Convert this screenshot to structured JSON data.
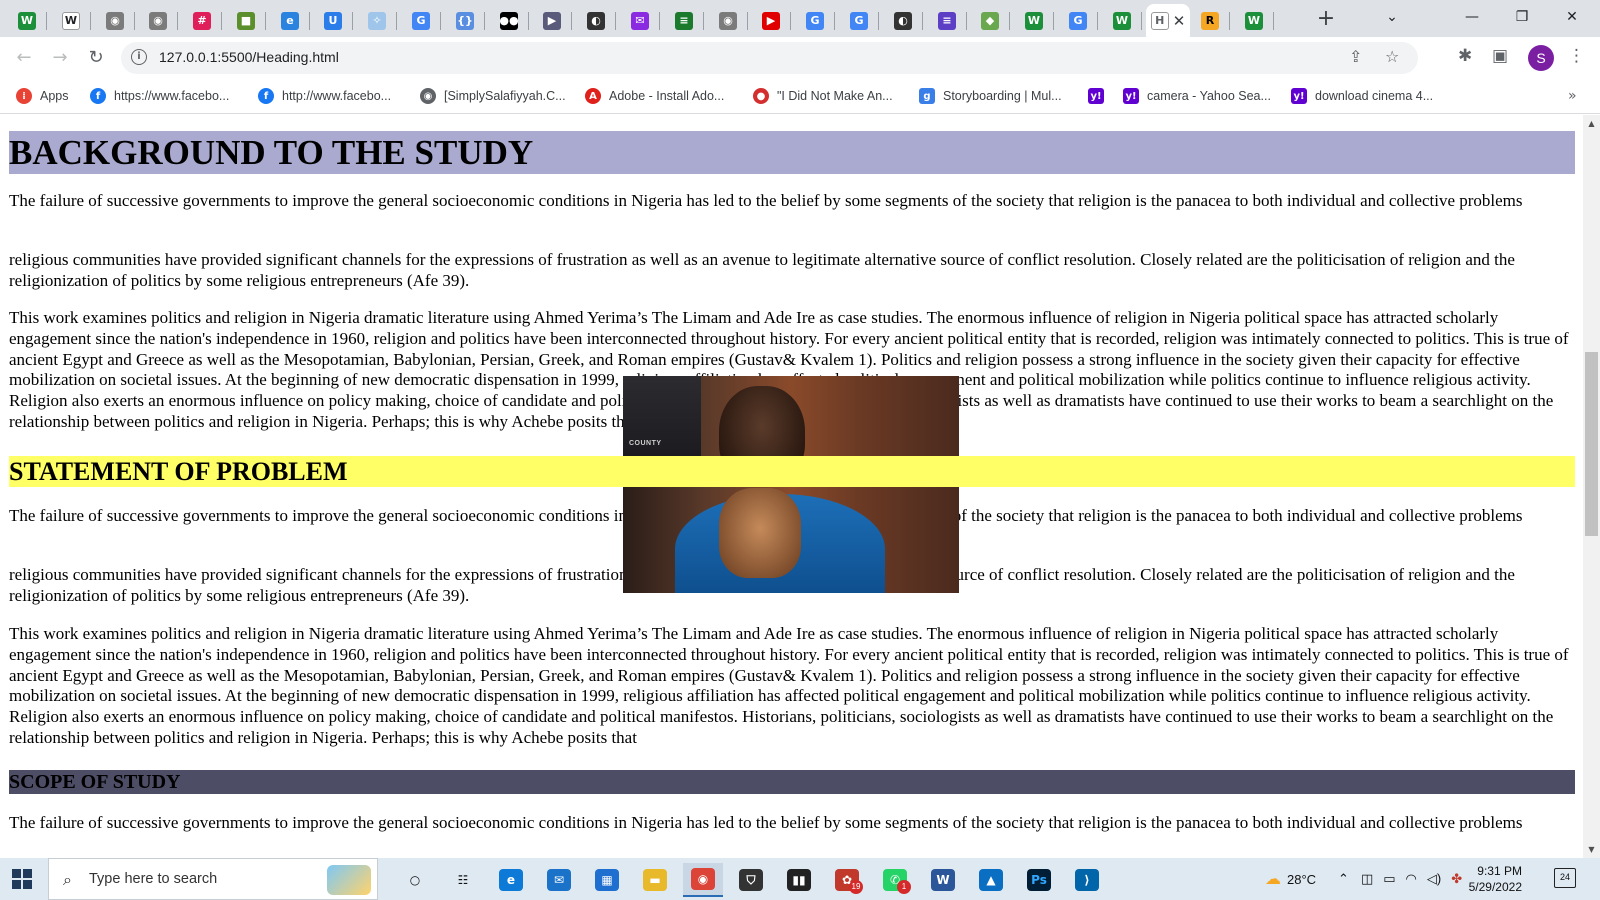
{
  "browser": {
    "tabs": [
      {
        "name": "wikipedia",
        "glyph": "W",
        "color": "#1b8f3a",
        "fg": "#fff"
      },
      {
        "name": "wikipedia-book",
        "glyph": "W",
        "color": "#ffffff",
        "fg": "#202124"
      },
      {
        "name": "globe",
        "glyph": "◉",
        "color": "#7b7b7b",
        "fg": "#fff"
      },
      {
        "name": "globe",
        "glyph": "◉",
        "color": "#7b7b7b",
        "fg": "#fff"
      },
      {
        "name": "slack",
        "glyph": "#",
        "color": "#e01e5a",
        "fg": "#fff"
      },
      {
        "name": "canva",
        "glyph": "■",
        "color": "#5b8f2c",
        "fg": "#fff"
      },
      {
        "name": "edge",
        "glyph": "e",
        "color": "#2b83e0",
        "fg": "#fff"
      },
      {
        "name": "word-u",
        "glyph": "U",
        "color": "#2b7de9",
        "fg": "#fff"
      },
      {
        "name": "spark",
        "glyph": "✧",
        "color": "#9fc6ea",
        "fg": "#fff"
      },
      {
        "name": "google",
        "glyph": "G",
        "color": "#4285f4",
        "fg": "#fff"
      },
      {
        "name": "braces",
        "glyph": "{}",
        "color": "#5a8ee0",
        "fg": "#fff"
      },
      {
        "name": "medium",
        "glyph": "●●",
        "color": "#000000",
        "fg": "#fff"
      },
      {
        "name": "play",
        "glyph": "▶",
        "color": "#5a5a7a",
        "fg": "#fff"
      },
      {
        "name": "github",
        "glyph": "◐",
        "color": "#333333",
        "fg": "#fff"
      },
      {
        "name": "mail",
        "glyph": "✉",
        "color": "#8a2be2",
        "fg": "#fff"
      },
      {
        "name": "foodhub",
        "glyph": "≡",
        "color": "#1b7a2c",
        "fg": "#fff"
      },
      {
        "name": "globe",
        "glyph": "◉",
        "color": "#7b7b7b",
        "fg": "#fff"
      },
      {
        "name": "youtube",
        "glyph": "▶",
        "color": "#e00000",
        "fg": "#fff"
      },
      {
        "name": "google",
        "glyph": "G",
        "color": "#4285f4",
        "fg": "#fff"
      },
      {
        "name": "google",
        "glyph": "G",
        "color": "#4285f4",
        "fg": "#fff"
      },
      {
        "name": "github",
        "glyph": "◐",
        "color": "#333333",
        "fg": "#fff"
      },
      {
        "name": "notes",
        "glyph": "≡",
        "color": "#5c3fc4",
        "fg": "#fff"
      },
      {
        "name": "maps",
        "glyph": "◆",
        "color": "#6aa84f",
        "fg": "#fff"
      },
      {
        "name": "wikipedia",
        "glyph": "W",
        "color": "#1b8f3a",
        "fg": "#fff"
      },
      {
        "name": "google",
        "glyph": "G",
        "color": "#4285f4",
        "fg": "#fff"
      },
      {
        "name": "wikipedia",
        "glyph": "W",
        "color": "#1b8f3a",
        "fg": "#fff"
      },
      {
        "name": "heading-page",
        "glyph": "H",
        "color": "#ffffff",
        "fg": "#5f6368",
        "active": true
      },
      {
        "name": "r-app",
        "glyph": "R",
        "color": "#f5a623",
        "fg": "#000"
      },
      {
        "name": "wikipedia",
        "glyph": "W",
        "color": "#1b8f3a",
        "fg": "#fff"
      }
    ],
    "new_tab_label": "+",
    "window_controls": {
      "tab_search": "⌄",
      "minimize": "—",
      "restore": "❐",
      "close": "✕"
    },
    "url": "127.0.0.1:5500/Heading.html",
    "profile_initial": "S",
    "bookmarks": [
      {
        "label": "Apps",
        "icon": "apps-grid",
        "color": "#e94335"
      },
      {
        "label": "https://www.facebo...",
        "icon": "facebook",
        "color": "#1877f2"
      },
      {
        "label": "http://www.facebo...",
        "icon": "facebook",
        "color": "#1877f2"
      },
      {
        "label": "[SimplySalafiyyah.C...",
        "icon": "globe",
        "color": "#5f6368"
      },
      {
        "label": "Adobe - Install Ado...",
        "icon": "adobe",
        "color": "#e0201a"
      },
      {
        "label": "\"I Did Not Make An...",
        "icon": "pin",
        "color": "#d32f2f"
      },
      {
        "label": "Storyboarding | Mul...",
        "icon": "storyboard",
        "color": "#3a7ee8"
      },
      {
        "label": "",
        "icon": "yahoo",
        "color": "#6001d2"
      },
      {
        "label": "camera - Yahoo Sea...",
        "icon": "yahoo",
        "color": "#6001d2"
      },
      {
        "label": "download cinema 4...",
        "icon": "yahoo",
        "color": "#6001d2"
      }
    ],
    "bookmarks_more": "»"
  },
  "page": {
    "heading1": "BACKGROUND TO THE STUDY",
    "heading2": "STATEMENT OF PROBLEM",
    "heading3": "SCOPE OF STUDY",
    "para1": "The failure of successive governments to improve the general socioeconomic conditions in Nigeria has led to the belief by some segments of the society that religion is the panacea to both individual and collective problems",
    "para2": "religious communities have provided significant channels for the expressions of frustration as well as an avenue to legitimate alternative source of conflict resolution. Closely related are the politicisation of religion and the religionization of politics by some religious entrepreneurs (Afe 39).",
    "para3": "This work examines politics and religion in Nigeria dramatic literature using Ahmed Yerima’s The Limam and Ade Ire as case studies. The enormous influence of religion in Nigeria political space has attracted scholarly engagement since the nation's independence in 1960, religion and politics have been interconnected throughout history. For every ancient political entity that is recorded, religion was intimately connected to politics. This is true of ancient Egypt and Greece as well as the Mesopotamian, Babylonian, Persian, Greek, and Roman empires (Gustav& Kvalem 1). Politics and religion possess a strong influence in the society given their capacity for effective mobilization on societal issues. At the beginning of new democratic dispensation in 1999, religious affiliation has affected political engagement and political mobilization while politics continue to influence religious activity. Religion also exerts an enormous influence on policy making, choice of candidate and political manifestos. Historians, politicians, sociologists as well as dramatists have continued to use their works to beam a searchlight on the relationship between politics and religion in Nigeria. Perhaps; this is why Achebe posits that",
    "photo_text": "COUNTY"
  },
  "taskbar": {
    "search_placeholder": "Type here to search",
    "apps": [
      {
        "name": "task-view",
        "glyph": "○",
        "color": "transparent",
        "fg": "#111"
      },
      {
        "name": "widgets",
        "glyph": "☷",
        "color": "transparent",
        "fg": "#111"
      },
      {
        "name": "edge",
        "glyph": "e",
        "color": "#0c7ad6",
        "fg": "#fff"
      },
      {
        "name": "mail",
        "glyph": "✉",
        "color": "#1a73c8",
        "fg": "#fff"
      },
      {
        "name": "store",
        "glyph": "▦",
        "color": "#1f6fd1",
        "fg": "#fff"
      },
      {
        "name": "explorer",
        "glyph": "▬",
        "color": "#e8b92b",
        "fg": "#fff"
      },
      {
        "name": "chrome",
        "glyph": "◉",
        "color": "#db4437",
        "fg": "#fff",
        "active": true
      },
      {
        "name": "vpn",
        "glyph": "⛉",
        "color": "#333",
        "fg": "#fff"
      },
      {
        "name": "audio",
        "glyph": "▮▮",
        "color": "#222",
        "fg": "#fff"
      },
      {
        "name": "colorful",
        "glyph": "✿",
        "color": "#c0392b",
        "fg": "#fff",
        "badge": "19"
      },
      {
        "name": "whatsapp",
        "glyph": "✆",
        "color": "#25d366",
        "fg": "#fff",
        "badge": "1"
      },
      {
        "name": "word",
        "glyph": "W",
        "color": "#2b579a",
        "fg": "#fff"
      },
      {
        "name": "photos",
        "glyph": "▲",
        "color": "#0a6fc2",
        "fg": "#fff"
      },
      {
        "name": "photoshop",
        "glyph": "Ps",
        "color": "#001e36",
        "fg": "#31a8ff"
      },
      {
        "name": "vscode",
        "glyph": "⟩",
        "color": "#0065a9",
        "fg": "#fff"
      }
    ],
    "weather": "28°C",
    "time": "9:31 PM",
    "date": "5/29/2022",
    "notifications": "24"
  },
  "scroll": {
    "thumb_start": 0.31,
    "thumb_size": 0.26
  }
}
